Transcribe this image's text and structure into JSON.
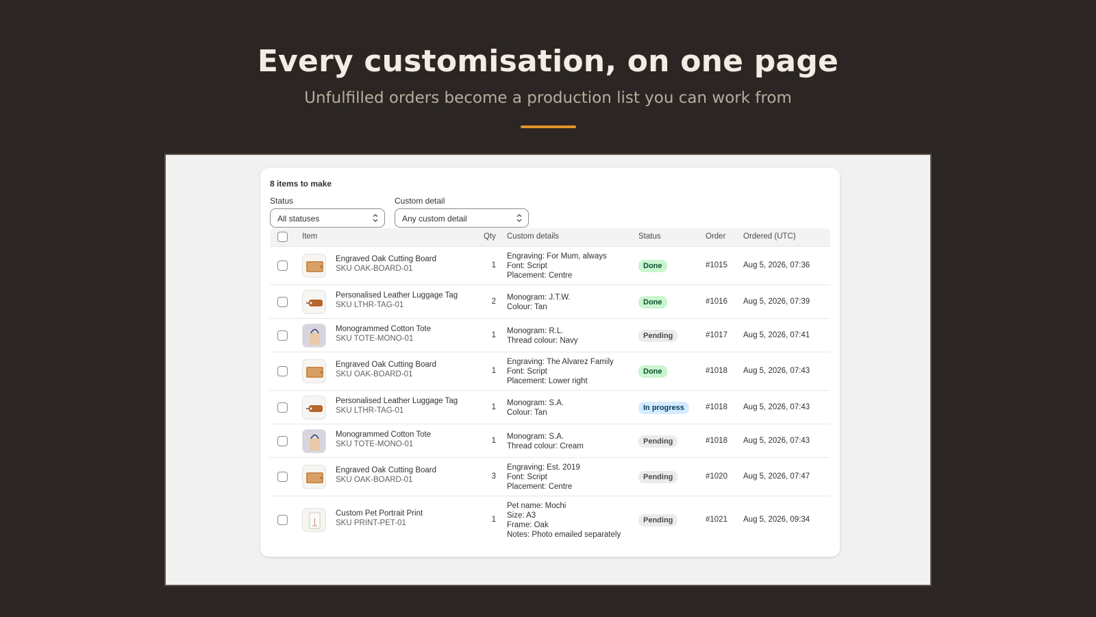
{
  "hero": {
    "title": "Every customisation, on one page",
    "subtitle": "Unfulfilled orders become a production list you can work from",
    "accent_color": "#e0942a"
  },
  "card": {
    "title": "8 items to make",
    "filters": {
      "status_label": "Status",
      "status_value": "All statuses",
      "detail_label": "Custom detail",
      "detail_value": "Any custom detail"
    }
  },
  "table": {
    "headers": {
      "item": "Item",
      "qty": "Qty",
      "details": "Custom details",
      "status": "Status",
      "order": "Order",
      "ordered": "Ordered (UTC)"
    },
    "status_colors": {
      "Done": {
        "bg": "#c9f5cf",
        "fg": "#0c5132"
      },
      "Pending": {
        "bg": "#ebebeb",
        "fg": "#4a4a4a"
      },
      "In progress": {
        "bg": "#d5ebff",
        "fg": "#003a5a"
      }
    },
    "rows": [
      {
        "thumb": "cutting-board",
        "name": "Engraved Oak Cutting Board",
        "sku": "SKU OAK-BOARD-01",
        "qty": "1",
        "details": [
          "Engraving: For Mum, always",
          "Font: Script",
          "Placement: Centre"
        ],
        "status": "Done",
        "order": "#1015",
        "date": "Aug 5, 2026, 07:36"
      },
      {
        "thumb": "luggage-tag",
        "name": "Personalised Leather Luggage Tag",
        "sku": "SKU LTHR-TAG-01",
        "qty": "2",
        "details": [
          "Monogram: J.T.W.",
          "Colour: Tan"
        ],
        "status": "Done",
        "order": "#1016",
        "date": "Aug 5, 2026, 07:39"
      },
      {
        "thumb": "tote",
        "name": "Monogrammed Cotton Tote",
        "sku": "SKU TOTE-MONO-01",
        "qty": "1",
        "details": [
          "Monogram: R.L.",
          "Thread colour: Navy"
        ],
        "status": "Pending",
        "order": "#1017",
        "date": "Aug 5, 2026, 07:41"
      },
      {
        "thumb": "cutting-board",
        "name": "Engraved Oak Cutting Board",
        "sku": "SKU OAK-BOARD-01",
        "qty": "1",
        "details": [
          "Engraving: The Alvarez Family",
          "Font: Script",
          "Placement: Lower right"
        ],
        "status": "Done",
        "order": "#1018",
        "date": "Aug 5, 2026, 07:43"
      },
      {
        "thumb": "luggage-tag",
        "name": "Personalised Leather Luggage Tag",
        "sku": "SKU LTHR-TAG-01",
        "qty": "1",
        "details": [
          "Monogram: S.A.",
          "Colour: Tan"
        ],
        "status": "In progress",
        "order": "#1018",
        "date": "Aug 5, 2026, 07:43"
      },
      {
        "thumb": "tote",
        "name": "Monogrammed Cotton Tote",
        "sku": "SKU TOTE-MONO-01",
        "qty": "1",
        "details": [
          "Monogram: S.A.",
          "Thread colour: Cream"
        ],
        "status": "Pending",
        "order": "#1018",
        "date": "Aug 5, 2026, 07:43"
      },
      {
        "thumb": "cutting-board",
        "name": "Engraved Oak Cutting Board",
        "sku": "SKU OAK-BOARD-01",
        "qty": "3",
        "details": [
          "Engraving: Est. 2019",
          "Font: Script",
          "Placement: Centre"
        ],
        "status": "Pending",
        "order": "#1020",
        "date": "Aug 5, 2026, 07:47"
      },
      {
        "thumb": "print",
        "name": "Custom Pet Portrait Print",
        "sku": "SKU PRINT-PET-01",
        "qty": "1",
        "details": [
          "Pet name: Mochi",
          "Size: A3",
          "Frame: Oak",
          "Notes: Photo emailed separately"
        ],
        "status": "Pending",
        "order": "#1021",
        "date": "Aug 5, 2026, 09:34"
      }
    ]
  }
}
